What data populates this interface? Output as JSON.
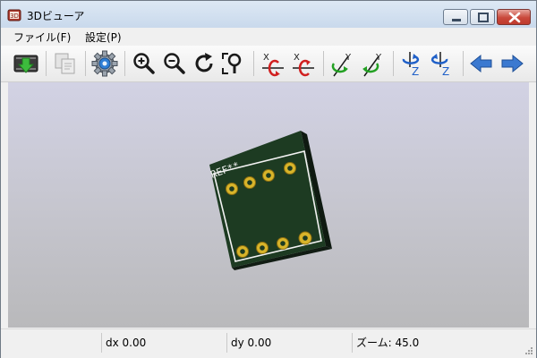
{
  "window": {
    "title": "3Dビューア"
  },
  "menu": {
    "items": [
      "ファイル(F)",
      "設定(P)"
    ]
  },
  "toolbar": {
    "buttons": [
      "reload-board-icon",
      "copy-to-clipboard-icon",
      "settings-icon",
      "zoom-in-icon",
      "zoom-out-icon",
      "redraw-icon",
      "zoom-fit-icon",
      "rotate-x-cw-icon",
      "rotate-x-ccw-icon",
      "rotate-y-cw-icon",
      "rotate-y-ccw-icon",
      "rotate-z-cw-icon",
      "rotate-z-ccw-icon",
      "pan-left-icon",
      "pan-right-icon"
    ],
    "axis_labels": {
      "x": "X",
      "y": "Y",
      "z": "Z"
    }
  },
  "board": {
    "reference": "REF**",
    "colors": {
      "soldermask": "#1d3b22",
      "silkscreen": "#f2f2f2",
      "pad": "#d8b42a"
    }
  },
  "statusbar": {
    "dx": "dx 0.00",
    "dy": "dy 0.00",
    "zoom": "ズーム: 45.0"
  }
}
